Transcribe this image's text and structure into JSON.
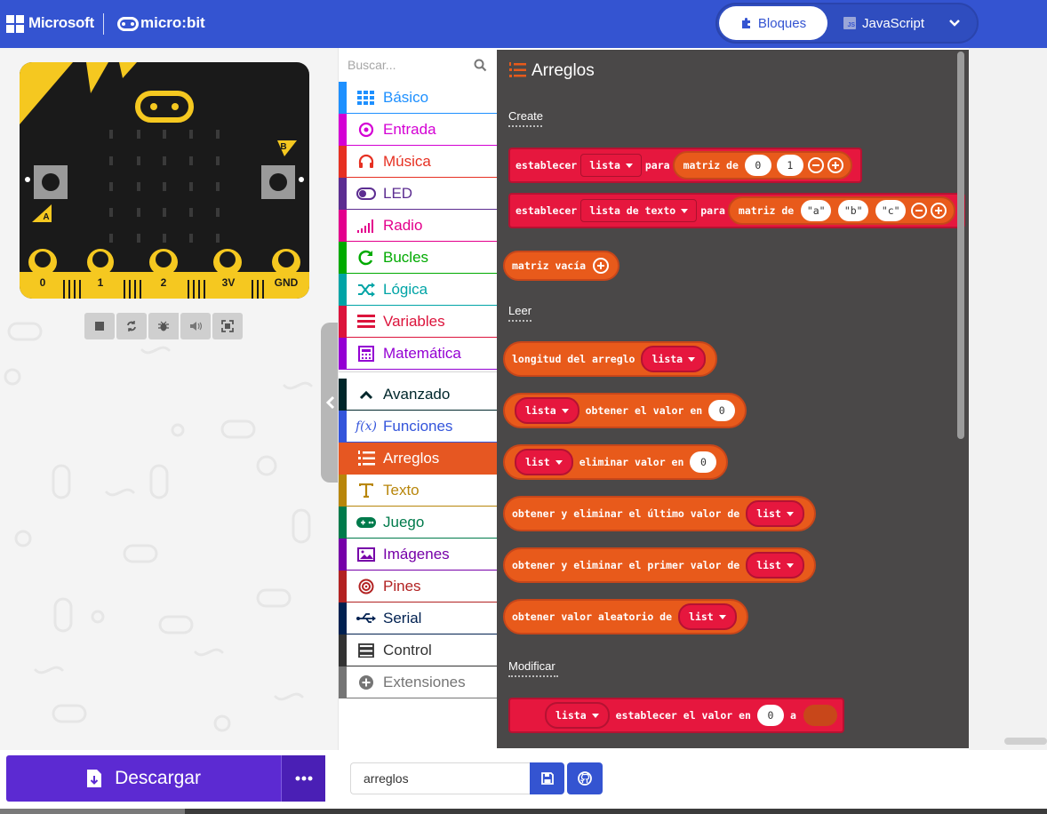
{
  "header": {
    "brand": "Microsoft",
    "product": "micro:bit",
    "tabs": [
      {
        "label": "Bloques",
        "active": true
      },
      {
        "label": "JavaScript",
        "active": false
      }
    ]
  },
  "simulator": {
    "pins": [
      "0",
      "1",
      "2",
      "3V",
      "GND"
    ],
    "button_a": "A",
    "button_b": "B",
    "controls": [
      "stop-icon",
      "restart-icon",
      "debug-icon",
      "mute-icon",
      "fullscreen-icon"
    ]
  },
  "toolbox": {
    "search_placeholder": "Buscar...",
    "categories": [
      {
        "label": "Básico",
        "color": "#1e90ff",
        "icon": "grid-icon"
      },
      {
        "label": "Entrada",
        "color": "#d400d4",
        "icon": "target-icon"
      },
      {
        "label": "Música",
        "color": "#e63022",
        "icon": "headphones-icon"
      },
      {
        "label": "LED",
        "color": "#5c2d91",
        "icon": "toggle-icon"
      },
      {
        "label": "Radio",
        "color": "#e3008c",
        "icon": "signal-icon"
      },
      {
        "label": "Bucles",
        "color": "#00aa00",
        "icon": "refresh-icon"
      },
      {
        "label": "Lógica",
        "color": "#00a4a6",
        "icon": "shuffle-icon"
      },
      {
        "label": "Variables",
        "color": "#dc143c",
        "icon": "list-icon"
      },
      {
        "label": "Matemática",
        "color": "#9400d3",
        "icon": "calculator-icon"
      },
      {
        "label": "Avanzado",
        "color": "#00272b",
        "icon": "chevron-up-icon"
      },
      {
        "label": "Funciones",
        "color": "#3455db",
        "icon": "function-icon"
      },
      {
        "label": "Arreglos",
        "color": "#e65722",
        "icon": "array-icon",
        "selected": true
      },
      {
        "label": "Texto",
        "color": "#b8860b",
        "icon": "text-icon"
      },
      {
        "label": "Juego",
        "color": "#007a4b",
        "icon": "gamepad-icon"
      },
      {
        "label": "Imágenes",
        "color": "#7600a8",
        "icon": "image-icon"
      },
      {
        "label": "Pines",
        "color": "#b22222",
        "icon": "bullseye-icon"
      },
      {
        "label": "Serial",
        "color": "#002050",
        "icon": "usb-icon"
      },
      {
        "label": "Control",
        "color": "#333333",
        "icon": "server-icon"
      },
      {
        "label": "Extensiones",
        "color": "#757575",
        "icon": "plus-circle-icon"
      }
    ]
  },
  "flyout": {
    "title": "Arreglos",
    "sections": {
      "create": "Create",
      "read": "Leer",
      "modify": "Modificar"
    },
    "blocks": {
      "set_list": {
        "kw": "establecer",
        "var": "lista",
        "to": "para",
        "arr": "matriz de",
        "v1": "0",
        "v2": "1"
      },
      "set_text_list": {
        "kw": "establecer",
        "var": "lista de texto",
        "to": "para",
        "arr": "matriz de",
        "v1": "\"a\"",
        "v2": "\"b\"",
        "v3": "\"c\""
      },
      "empty_array": {
        "label": "matriz vacía"
      },
      "length": {
        "label": "longitud del arreglo",
        "var": "lista"
      },
      "get_value": {
        "var": "lista",
        "label": "obtener el valor en",
        "index": "0"
      },
      "remove_value": {
        "var": "list",
        "label": "eliminar valor en",
        "index": "0"
      },
      "pop": {
        "label": "obtener y eliminar el último valor de",
        "var": "list"
      },
      "shift": {
        "label": "obtener y eliminar el primer valor de",
        "var": "list"
      },
      "random": {
        "label": "obtener valor aleatorio de",
        "var": "list"
      },
      "set_value": {
        "var": "lista",
        "label": "establecer el valor en",
        "index": "0",
        "to": "a"
      }
    }
  },
  "footer": {
    "download_label": "Descargar",
    "project_name": "arreglos"
  }
}
